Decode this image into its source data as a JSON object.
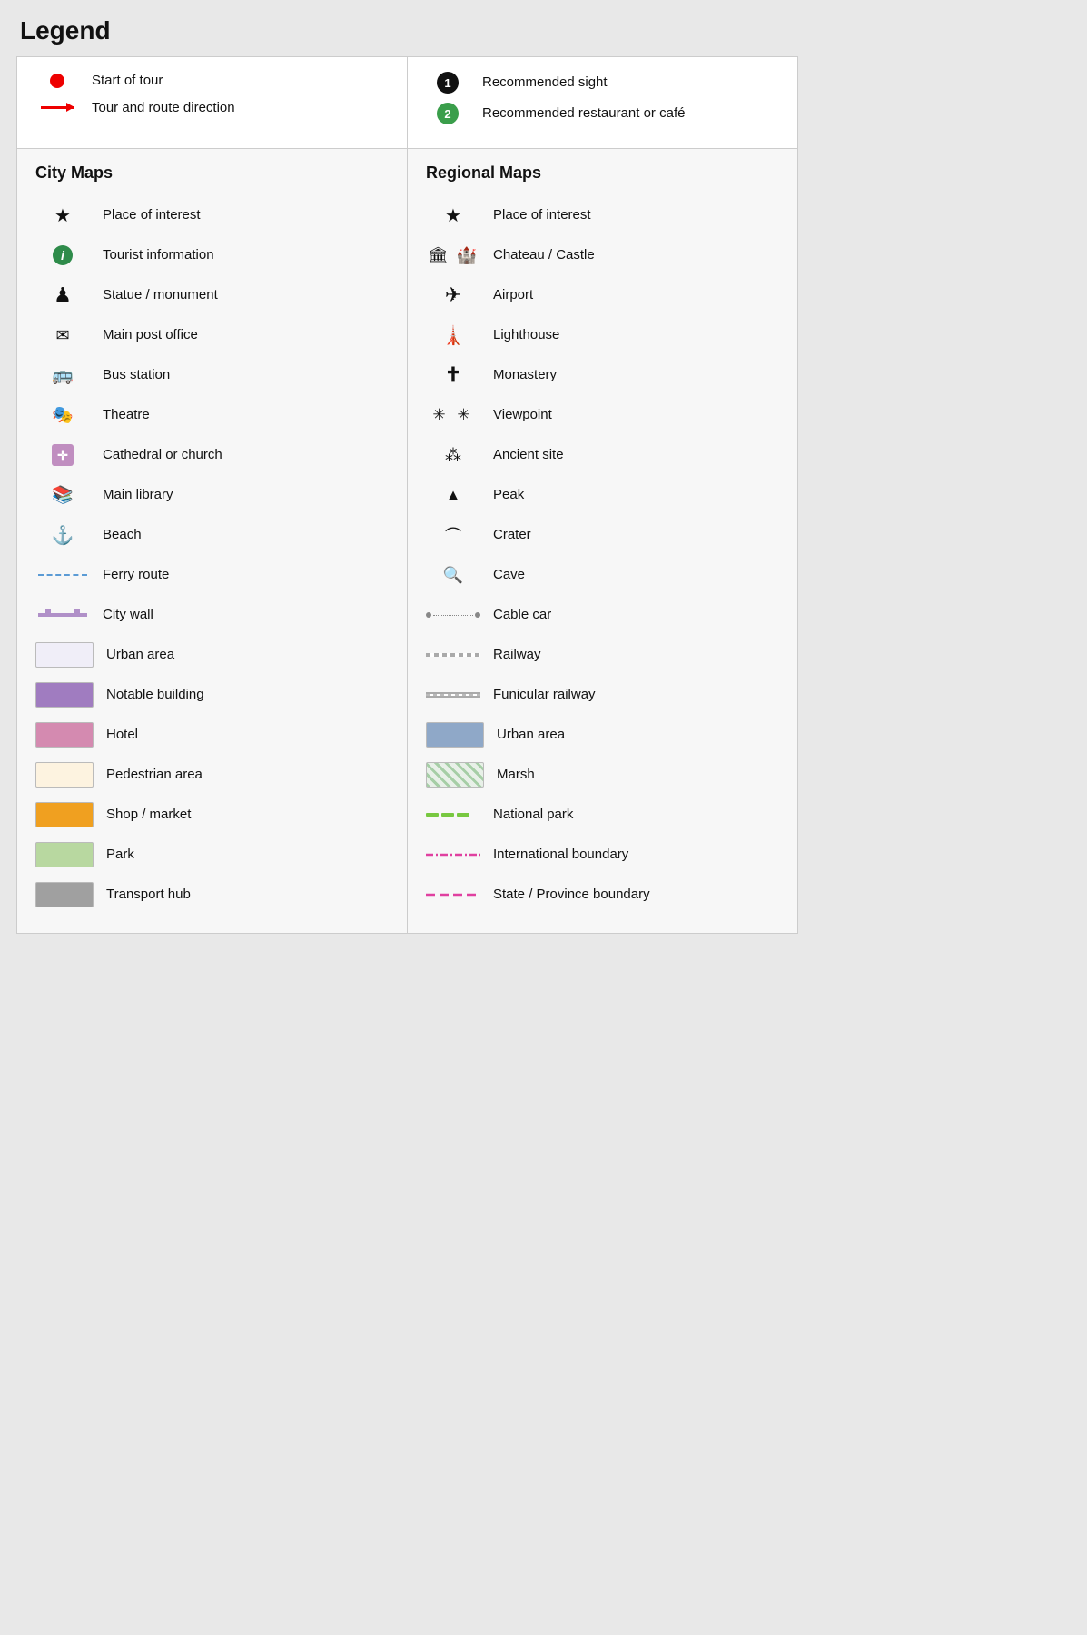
{
  "title": "Legend",
  "header": {
    "left": [
      {
        "type": "red-dot",
        "label": "Start of tour"
      },
      {
        "type": "red-arrow",
        "label": "Tour and route direction"
      }
    ],
    "right": [
      {
        "type": "circle-black",
        "number": "1",
        "label": "Recommended sight"
      },
      {
        "type": "circle-green",
        "number": "2",
        "label": "Recommended restaurant or café"
      }
    ]
  },
  "cityMaps": {
    "title": "City Maps",
    "items": [
      {
        "icon": "star",
        "label": "Place of interest"
      },
      {
        "icon": "info",
        "label": "Tourist information"
      },
      {
        "icon": "statue",
        "label": "Statue / monument"
      },
      {
        "icon": "envelope",
        "label": "Main post office"
      },
      {
        "icon": "bus",
        "label": "Bus station"
      },
      {
        "icon": "theatre",
        "label": "Theatre"
      },
      {
        "icon": "church",
        "label": "Cathedral or church"
      },
      {
        "icon": "library",
        "label": "Main library"
      },
      {
        "icon": "beach",
        "label": "Beach"
      },
      {
        "icon": "ferry",
        "label": "Ferry route"
      },
      {
        "icon": "citywall",
        "label": "City wall"
      },
      {
        "icon": "urban",
        "label": "Urban area"
      },
      {
        "icon": "notable",
        "label": "Notable building"
      },
      {
        "icon": "hotel",
        "label": "Hotel"
      },
      {
        "icon": "pedestrian",
        "label": "Pedestrian area"
      },
      {
        "icon": "shop",
        "label": "Shop / market"
      },
      {
        "icon": "park",
        "label": "Park"
      },
      {
        "icon": "transport",
        "label": "Transport hub"
      }
    ]
  },
  "regionalMaps": {
    "title": "Regional Maps",
    "items": [
      {
        "icon": "star",
        "label": "Place of interest"
      },
      {
        "icon": "castle",
        "label": "Chateau / Castle"
      },
      {
        "icon": "airport",
        "label": "Airport"
      },
      {
        "icon": "lighthouse",
        "label": "Lighthouse"
      },
      {
        "icon": "cross",
        "label": "Monastery"
      },
      {
        "icon": "viewpoint",
        "label": "Viewpoint"
      },
      {
        "icon": "ancient",
        "label": "Ancient site"
      },
      {
        "icon": "peak",
        "label": "Peak"
      },
      {
        "icon": "crater",
        "label": "Crater"
      },
      {
        "icon": "cave",
        "label": "Cave"
      },
      {
        "icon": "cablecar",
        "label": "Cable car"
      },
      {
        "icon": "railway",
        "label": "Railway"
      },
      {
        "icon": "funicular",
        "label": "Funicular railway"
      },
      {
        "icon": "urban-regional",
        "label": "Urban area"
      },
      {
        "icon": "marsh",
        "label": "Marsh"
      },
      {
        "icon": "natpark",
        "label": "National park"
      },
      {
        "icon": "intlboundary",
        "label": "International boundary"
      },
      {
        "icon": "stateboundary",
        "label": "State / Province boundary"
      }
    ]
  }
}
